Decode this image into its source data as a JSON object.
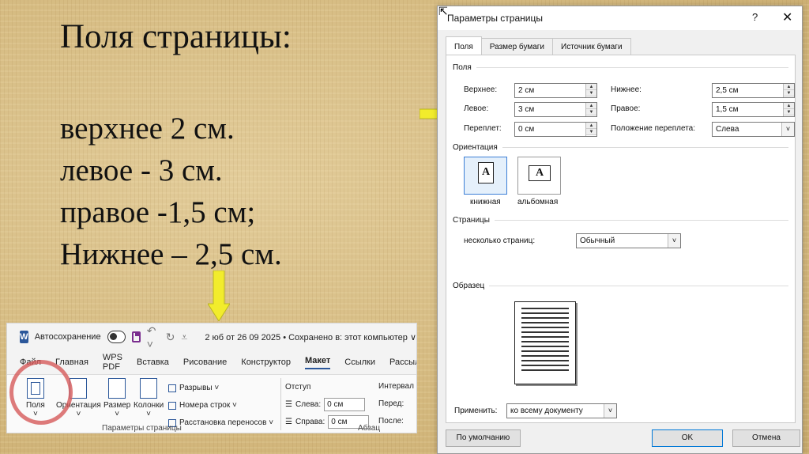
{
  "slide": {
    "title": "Поля страницы:",
    "lines": [
      "верхнее 2 см.",
      "левое - 3 см.",
      "правое -1,5 см;",
      "Нижнее – 2,5 см."
    ]
  },
  "colors": {
    "arrow": "#f2ec2c",
    "accent": "#2b579a",
    "highlight": "#d65a5a"
  },
  "ribbon": {
    "autosave_label": "Автосохранение",
    "doc_status": "2 юб от 26 09 2025 • Сохранено в: этот компьютер ∨",
    "tabs": [
      "Файл",
      "Главная",
      "WPS PDF",
      "Вставка",
      "Рисование",
      "Конструктор",
      "Макет",
      "Ссылки",
      "Рассыл"
    ],
    "active_tab": "Макет",
    "buttons": {
      "margins": "Поля",
      "orientation": "Ориентация",
      "size": "Размер",
      "columns": "Колонки"
    },
    "list": [
      "Разрывы ˅",
      "Номера строк ˅",
      "Расстановка переносов ˅"
    ],
    "group_page_setup": "Параметры страницы",
    "indent": {
      "title": "Отступ",
      "left_label": "Слева:",
      "left_value": "0 см",
      "right_label": "Справа:",
      "right_value": "0 см"
    },
    "interval": {
      "title": "Интервал",
      "before": "Перед:",
      "after": "После:"
    },
    "group_paragraph": "Абзац"
  },
  "dialog": {
    "title": "Параметры страницы",
    "help": "?",
    "close": "✕",
    "tabs": [
      "Поля",
      "Размер бумаги",
      "Источник бумаги"
    ],
    "active_tab": "Поля",
    "margins_section": "Поля",
    "fields": {
      "top_label": "Верхнее:",
      "top_value": "2 см",
      "bottom_label": "Нижнее:",
      "bottom_value": "2,5 см",
      "left_label": "Левое:",
      "left_value": "3 см",
      "right_label": "Правое:",
      "right_value": "1,5 см",
      "gutter_label": "Переплет:",
      "gutter_value": "0 см",
      "gutter_pos_label": "Положение переплета:",
      "gutter_pos_value": "Слева"
    },
    "orientation_section": "Ориентация",
    "portrait": "книжная",
    "landscape": "альбомная",
    "pages_section": "Страницы",
    "multiple_pages_label": "несколько страниц:",
    "multiple_pages_value": "Обычный",
    "preview_section": "Образец",
    "apply_label": "Применить:",
    "apply_value": "ко всему документу",
    "default_button": "По умолчанию",
    "ok_button": "OK",
    "cancel_button": "Отмена"
  }
}
